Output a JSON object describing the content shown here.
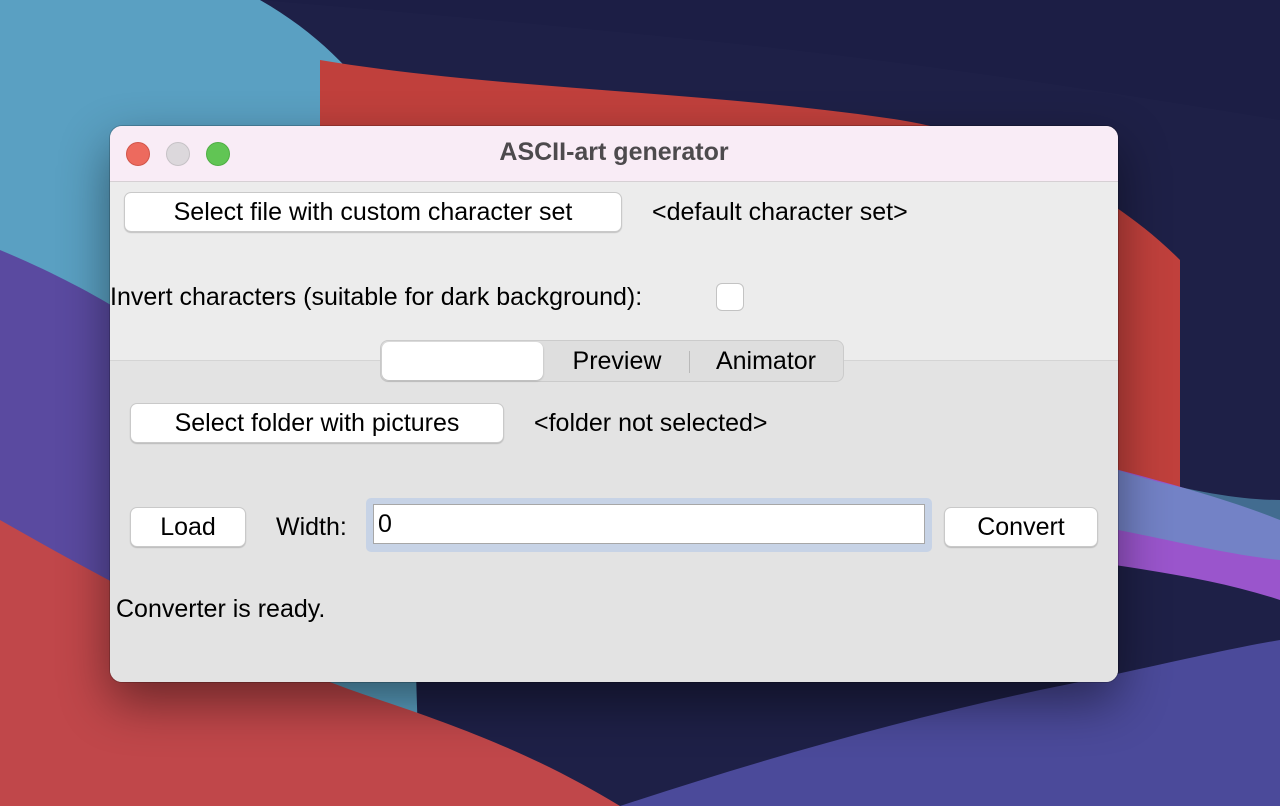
{
  "window": {
    "title": "ASCII-art generator"
  },
  "charset": {
    "button_label": "Select file with custom character set",
    "current_value": "<default character set>"
  },
  "invert": {
    "label": "Invert characters (suitable for dark background):",
    "checked": false
  },
  "tabs": {
    "items": [
      {
        "label": "",
        "selected": true
      },
      {
        "label": "Preview",
        "selected": false
      },
      {
        "label": "Animator",
        "selected": false
      }
    ]
  },
  "converter": {
    "folder_button_label": "Select folder with pictures",
    "folder_value": "<folder not selected>",
    "load_label": "Load",
    "width_label": "Width:",
    "width_value": "0",
    "convert_label": "Convert",
    "status": "Converter is ready."
  },
  "colors": {
    "titlebar": "#f9ecf6",
    "window_bg": "#ececec",
    "tabpane_bg": "#e3e3e3",
    "focus_ring": "#c7d3e6",
    "close": "#ed6a5e",
    "minimize": "#dcd8dc",
    "zoom": "#61c554"
  }
}
